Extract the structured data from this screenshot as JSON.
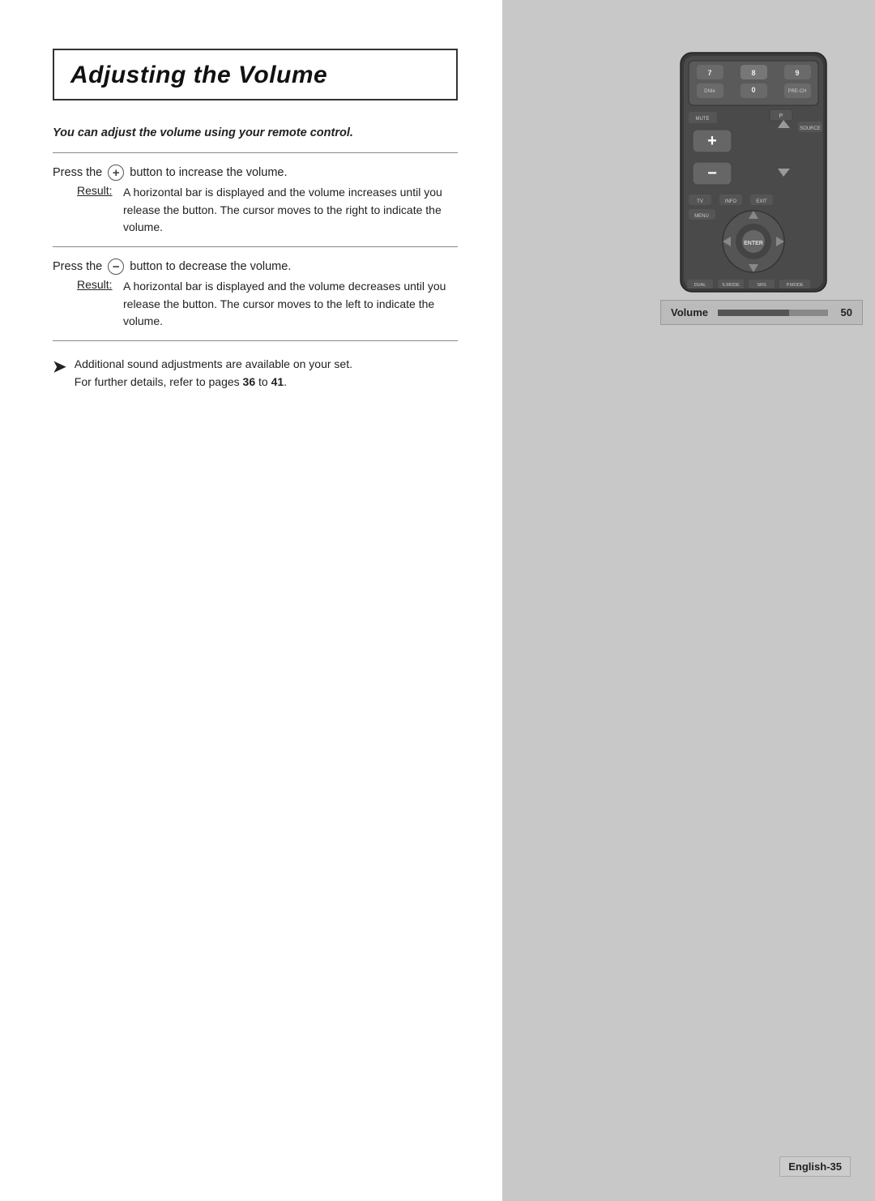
{
  "page": {
    "title": "Adjusting the Volume",
    "intro": "You can adjust the volume using your remote control.",
    "sections": [
      {
        "press_text_before": "Press the",
        "button_symbol": "+",
        "press_text_after": "button to increase the volume.",
        "result_label": "Result:",
        "result_text": "A horizontal bar is displayed and the volume increases until you release the button. The cursor moves to the right to indicate the volume."
      },
      {
        "press_text_before": "Press the",
        "button_symbol": "−",
        "press_text_after": "button to decrease the volume.",
        "result_label": "Result:",
        "result_text": "A horizontal bar is displayed and the volume decreases until you release the button. The cursor moves to the left to indicate the volume."
      }
    ],
    "tip": "Additional sound adjustments are available on your set. For further details, refer to pages 36 to 41.",
    "tip_pages_bold": [
      "36",
      "41"
    ],
    "volume_label": "Volume",
    "volume_value": "50",
    "page_number": "English-35"
  }
}
